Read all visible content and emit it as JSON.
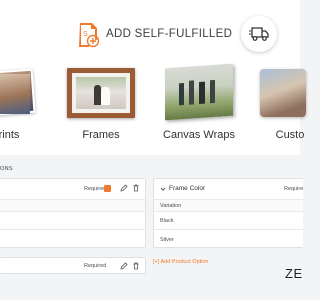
{
  "header": {
    "title": "ADD SELF-FULFILLED"
  },
  "products": [
    {
      "label": "rints"
    },
    {
      "label": "Frames"
    },
    {
      "label": "Canvas Wraps"
    },
    {
      "label": "Custo"
    }
  ],
  "options_section": {
    "label": "ONS"
  },
  "left_panel": {
    "required_label": "Required"
  },
  "right_panel": {
    "title": "Frame Color",
    "required_label": "Require",
    "column_header": "Variation",
    "variations": [
      "Black",
      "Silver"
    ]
  },
  "second_left_panel": {
    "required_label": "Required"
  },
  "add_option_label": "[+] Add Product Option",
  "brand_mark": "ZE",
  "colors": {
    "accent": "#f07a2c",
    "text": "#3c3f44",
    "border": "#dfe1e5"
  }
}
